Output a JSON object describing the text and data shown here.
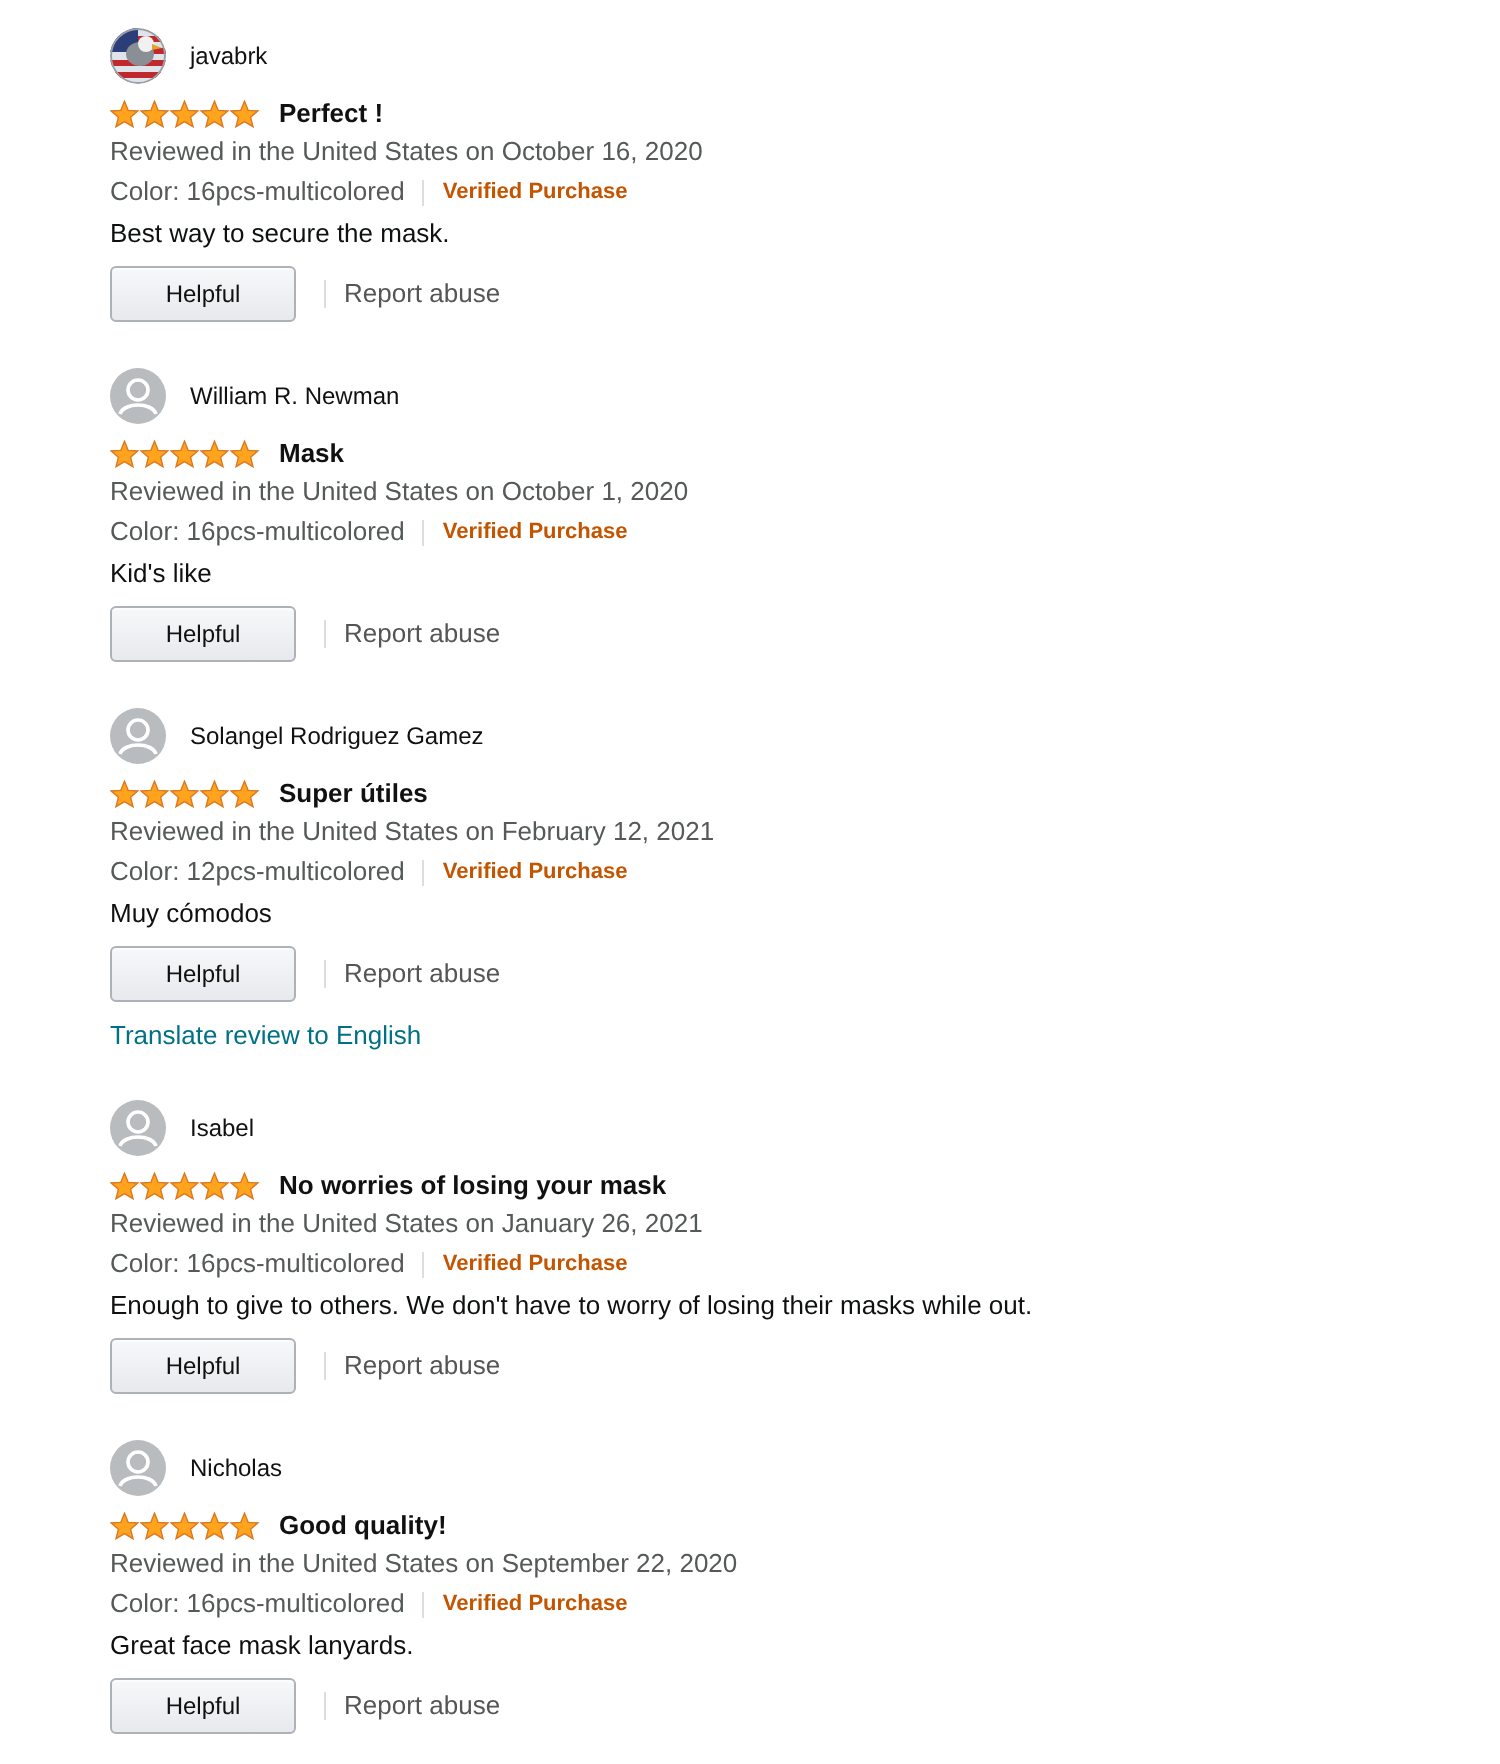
{
  "reviews": [
    {
      "reviewer": "javabrk",
      "kind": "picture",
      "stars": 5,
      "title": "Perfect !",
      "date": "Reviewed in the United States on October 16, 2020",
      "variant": "Color: 16pcs-multicolored",
      "verified": "Verified Purchase",
      "body": "Best way to secure the mask.",
      "helpful": "Helpful",
      "report": "Report abuse"
    },
    {
      "reviewer": "William R. Newman",
      "kind": "default",
      "stars": 5,
      "title": "Mask",
      "date": "Reviewed in the United States on October 1, 2020",
      "variant": "Color: 16pcs-multicolored",
      "verified": "Verified Purchase",
      "body": "Kid's like",
      "helpful": "Helpful",
      "report": "Report abuse"
    },
    {
      "reviewer": "Solangel Rodriguez Gamez",
      "kind": "default",
      "stars": 5,
      "title": "Super útiles",
      "date": "Reviewed in the United States on February 12, 2021",
      "variant": "Color: 12pcs-multicolored",
      "verified": "Verified Purchase",
      "body": "Muy cómodos",
      "helpful": "Helpful",
      "report": "Report abuse",
      "translate": "Translate review to English"
    },
    {
      "reviewer": "Isabel",
      "kind": "default",
      "stars": 5,
      "title": "No worries of losing your mask",
      "date": "Reviewed in the United States on January 26, 2021",
      "variant": "Color: 16pcs-multicolored",
      "verified": "Verified Purchase",
      "body": "Enough to give to others. We don't have to worry of losing their masks while out.",
      "helpful": "Helpful",
      "report": "Report abuse"
    },
    {
      "reviewer": "Nicholas",
      "kind": "default",
      "stars": 5,
      "title": "Good quality!",
      "date": "Reviewed in the United States on September 22, 2020",
      "variant": "Color: 16pcs-multicolored",
      "verified": "Verified Purchase",
      "body": "Great face mask lanyards.",
      "helpful": "Helpful",
      "report": "Report abuse"
    }
  ]
}
